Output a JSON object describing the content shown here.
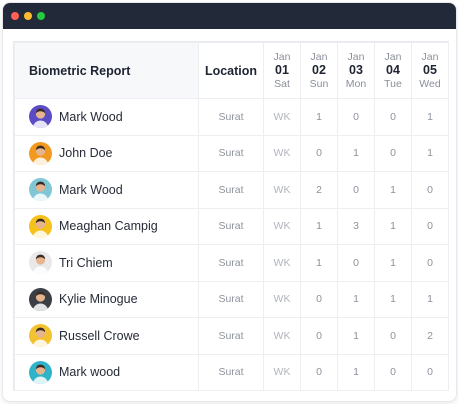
{
  "table": {
    "title": "Biometric Report",
    "location_header": "Location",
    "days": [
      {
        "month": "Jan",
        "date": "01",
        "weekday": "Sat"
      },
      {
        "month": "Jan",
        "date": "02",
        "weekday": "Sun"
      },
      {
        "month": "Jan",
        "date": "03",
        "weekday": "Mon"
      },
      {
        "month": "Jan",
        "date": "04",
        "weekday": "Tue"
      },
      {
        "month": "Jan",
        "date": "05",
        "weekday": "Wed"
      }
    ],
    "rows": [
      {
        "name": "Mark Wood",
        "location": "Surat",
        "cells": [
          "WK",
          "1",
          "0",
          "0",
          "1"
        ],
        "avatar_color": "#5b4bc4"
      },
      {
        "name": "John Doe",
        "location": "Surat",
        "cells": [
          "WK",
          "0",
          "1",
          "0",
          "1"
        ],
        "avatar_color": "#f29a1f"
      },
      {
        "name": "Mark Wood",
        "location": "Surat",
        "cells": [
          "WK",
          "2",
          "0",
          "1",
          "0"
        ],
        "avatar_color": "#7fc6d6"
      },
      {
        "name": "Meaghan Campig",
        "location": "Surat",
        "cells": [
          "WK",
          "1",
          "3",
          "1",
          "0"
        ],
        "avatar_color": "#f4c21b"
      },
      {
        "name": "Tri Chiem",
        "location": "Surat",
        "cells": [
          "WK",
          "1",
          "0",
          "1",
          "0"
        ],
        "avatar_color": "#e9e9e9"
      },
      {
        "name": "Kylie Minogue",
        "location": "Surat",
        "cells": [
          "WK",
          "0",
          "1",
          "1",
          "1"
        ],
        "avatar_color": "#3b3f45"
      },
      {
        "name": "Russell Crowe",
        "location": "Surat",
        "cells": [
          "WK",
          "0",
          "1",
          "0",
          "2"
        ],
        "avatar_color": "#f2c230"
      },
      {
        "name": "Mark wood",
        "location": "Surat",
        "cells": [
          "WK",
          "0",
          "1",
          "0",
          "0"
        ],
        "avatar_color": "#2fb3c9"
      }
    ]
  },
  "colors": {
    "titlebar": "#222a3a",
    "window_dots": [
      "#ff5f56",
      "#ffbd2e",
      "#27c93f"
    ]
  }
}
